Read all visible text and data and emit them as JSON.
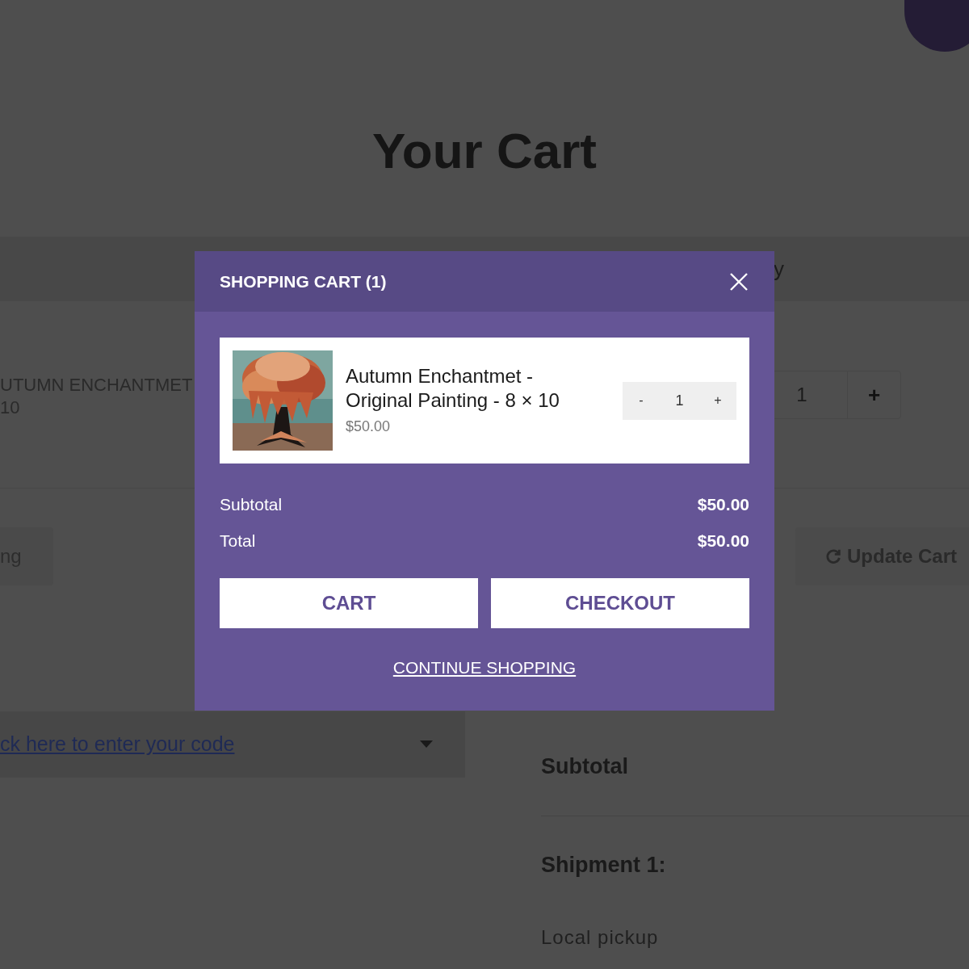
{
  "page": {
    "title": "Your Cart",
    "table_header": {
      "column_cut": "y"
    },
    "item": {
      "name_line_1": "UTUMN ENCHANTMET",
      "name_line_2": "10",
      "quantity": "1",
      "plus": "+"
    },
    "continue_button": "ng",
    "update_button": "Update Cart",
    "coupon": {
      "link": "ck here to enter your code"
    },
    "totals": {
      "subtotal_label": "Subtotal",
      "shipment_label": "Shipment 1:",
      "shipping_method": "Local pickup"
    }
  },
  "modal": {
    "title": "SHOPPING CART",
    "count": "(1)",
    "items": [
      {
        "kind": "picture",
        "name": "Autumn Enchantmet - Original Painting - 8 × 10",
        "price": "$50.00",
        "minus": "-",
        "quantity": "1",
        "plus": "+"
      }
    ],
    "summary": [
      {
        "label": "Subtotal",
        "value": "$50.00"
      },
      {
        "label": "Total",
        "value": "$50.00"
      }
    ],
    "buttons": [
      "CART",
      "CHECKOUT"
    ],
    "continue_link": "CONTINUE SHOPPING"
  }
}
